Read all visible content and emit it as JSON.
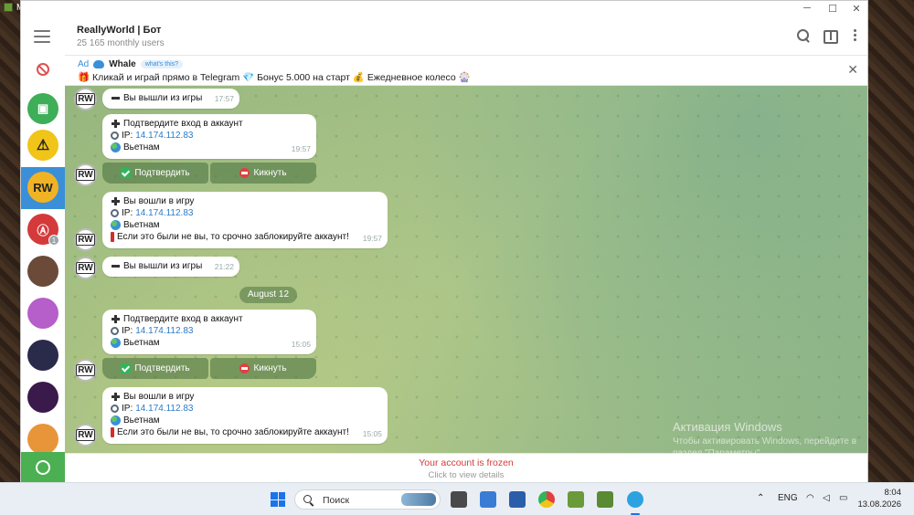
{
  "desktop": {
    "window_tab": "M"
  },
  "window": {
    "minimize": "─",
    "maximize": "☐",
    "close": "✕"
  },
  "chat": {
    "title": "ReallyWorld | Бот",
    "subtitle": "25 165 monthly users"
  },
  "sidebar": {
    "unread_badge": "1",
    "active_avatar_label": "RW"
  },
  "ad": {
    "label": "Ad",
    "name": "Whale",
    "chip": "what's this?",
    "text": "🎁 Кликай и играй прямо в Telegram 💎 Бонус 5.000 на старт 💰 Ежедневное колесо 🎡"
  },
  "bot_avatar_label": "RW",
  "messages": [
    {
      "lines": [
        "Вы вышли из игры"
      ],
      "time": "17:57"
    },
    {
      "lines": [
        "Подтвердите вход в аккаунт",
        "14.174.112.83",
        "Вьетнам"
      ],
      "ip_prefix": "IP:",
      "time": "19:57"
    },
    {
      "lines": [
        "Вы вошли в игру",
        "14.174.112.83",
        "Вьетнам",
        "Если это были не вы, то срочно заблокируйте аккаунт!"
      ],
      "ip_prefix": "IP:",
      "time": "19:57"
    },
    {
      "lines": [
        "Вы вышли из игры"
      ],
      "time": "21:22"
    },
    {
      "lines": [
        "Подтвердите вход в аккаунт",
        "14.174.112.83",
        "Вьетнам"
      ],
      "ip_prefix": "IP:",
      "time": "15:05"
    },
    {
      "lines": [
        "Вы вошли в игру",
        "14.174.112.83",
        "Вьетнам",
        "Если это были не вы, то срочно заблокируйте аккаунт!"
      ],
      "ip_prefix": "IP:",
      "time": "15:05"
    }
  ],
  "buttons": {
    "confirm": "Подтвердить",
    "kick": "Кикнуть"
  },
  "date_separator": "August 12",
  "frozen": {
    "title": "Your account is frozen",
    "subtitle": "Click to view details"
  },
  "watermark": {
    "line1": "Активация Windows",
    "line2": "Чтобы активировать Windows, перейдите в",
    "line3": "раздел \"Параметры\"."
  },
  "taskbar": {
    "search_placeholder": "Поиск",
    "language": "ENG",
    "time": "8:04",
    "date": "13.08.2026"
  },
  "colors": {
    "accent": "#3a8fd8",
    "frozen": "#d23c3c",
    "confirm": "#2fb65a",
    "kick": "#e04040"
  }
}
